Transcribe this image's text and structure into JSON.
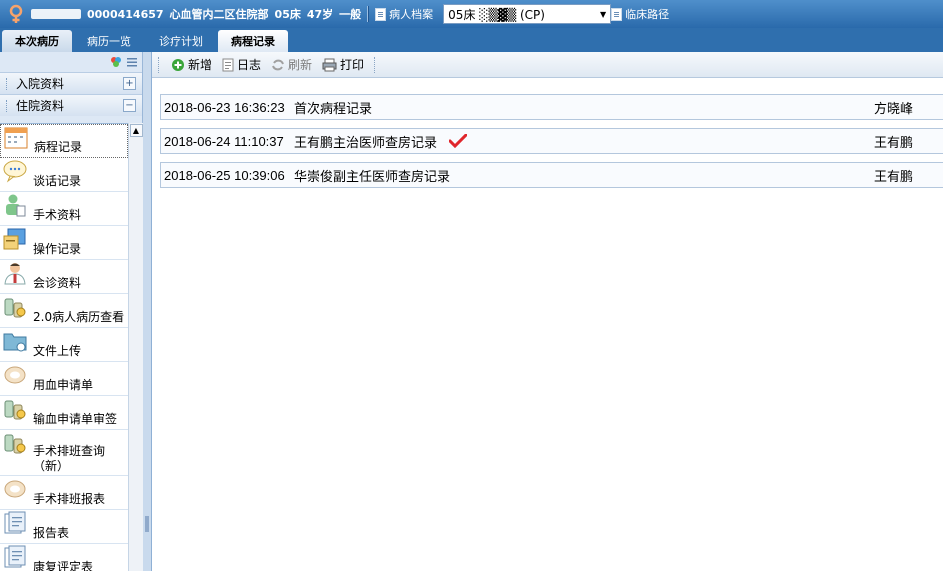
{
  "header": {
    "patient_id": "0000414657",
    "department": "心血管内二区住院部",
    "bed": "05床",
    "age": "47岁",
    "level": "一般",
    "patient_archive_label": "病人档案",
    "bed_select_value": "05床 ░▒▓▒ (CP)",
    "clinical_path_label": "临床路径"
  },
  "tabs": [
    {
      "label": "本次病历"
    },
    {
      "label": "病历一览"
    },
    {
      "label": "诊疗计划"
    },
    {
      "label": "病程记录"
    }
  ],
  "sidebar": {
    "sections": [
      {
        "label": "入院资料",
        "toggle": "+"
      },
      {
        "label": "住院资料",
        "toggle": "−"
      }
    ],
    "items": [
      {
        "label": "病程记录",
        "icon": "calendar-icon"
      },
      {
        "label": "谈话记录",
        "icon": "speech-bubble-icon"
      },
      {
        "label": "手术资料",
        "icon": "surgeon-icon"
      },
      {
        "label": "操作记录",
        "icon": "clipboard-icon"
      },
      {
        "label": "会诊资料",
        "icon": "doctor-icon"
      },
      {
        "label": "2.0病人病历查看",
        "icon": "bottles-icon"
      },
      {
        "label": "文件上传",
        "icon": "folder-upload-icon"
      },
      {
        "label": "用血申请单",
        "icon": "blood-drop-icon"
      },
      {
        "label": "输血申请单审签",
        "icon": "bottles-icon"
      },
      {
        "label": "手术排班查询（新）",
        "icon": "bottles-icon"
      },
      {
        "label": "手术排班报表",
        "icon": "blood-drop-icon"
      },
      {
        "label": "报告表",
        "icon": "report-icon"
      },
      {
        "label": "康复评定表",
        "icon": "report-icon"
      }
    ]
  },
  "toolbar": {
    "new_label": "新增",
    "log_label": "日志",
    "refresh_label": "刷新",
    "print_label": "打印"
  },
  "records": [
    {
      "time": "2018-06-23 16:36:23",
      "title": "首次病程记录",
      "author": "方晓峰",
      "signed": false
    },
    {
      "time": "2018-06-24 11:10:37",
      "title": "王有鹏主治医师查房记录",
      "author": "王有鹏",
      "signed": true
    },
    {
      "time": "2018-06-25 10:39:06",
      "title": "华崇俊副主任医师查房记录",
      "author": "王有鹏",
      "signed": false
    }
  ],
  "colors": {
    "header_blue": "#2a6aab",
    "check_red": "#e0262c"
  }
}
